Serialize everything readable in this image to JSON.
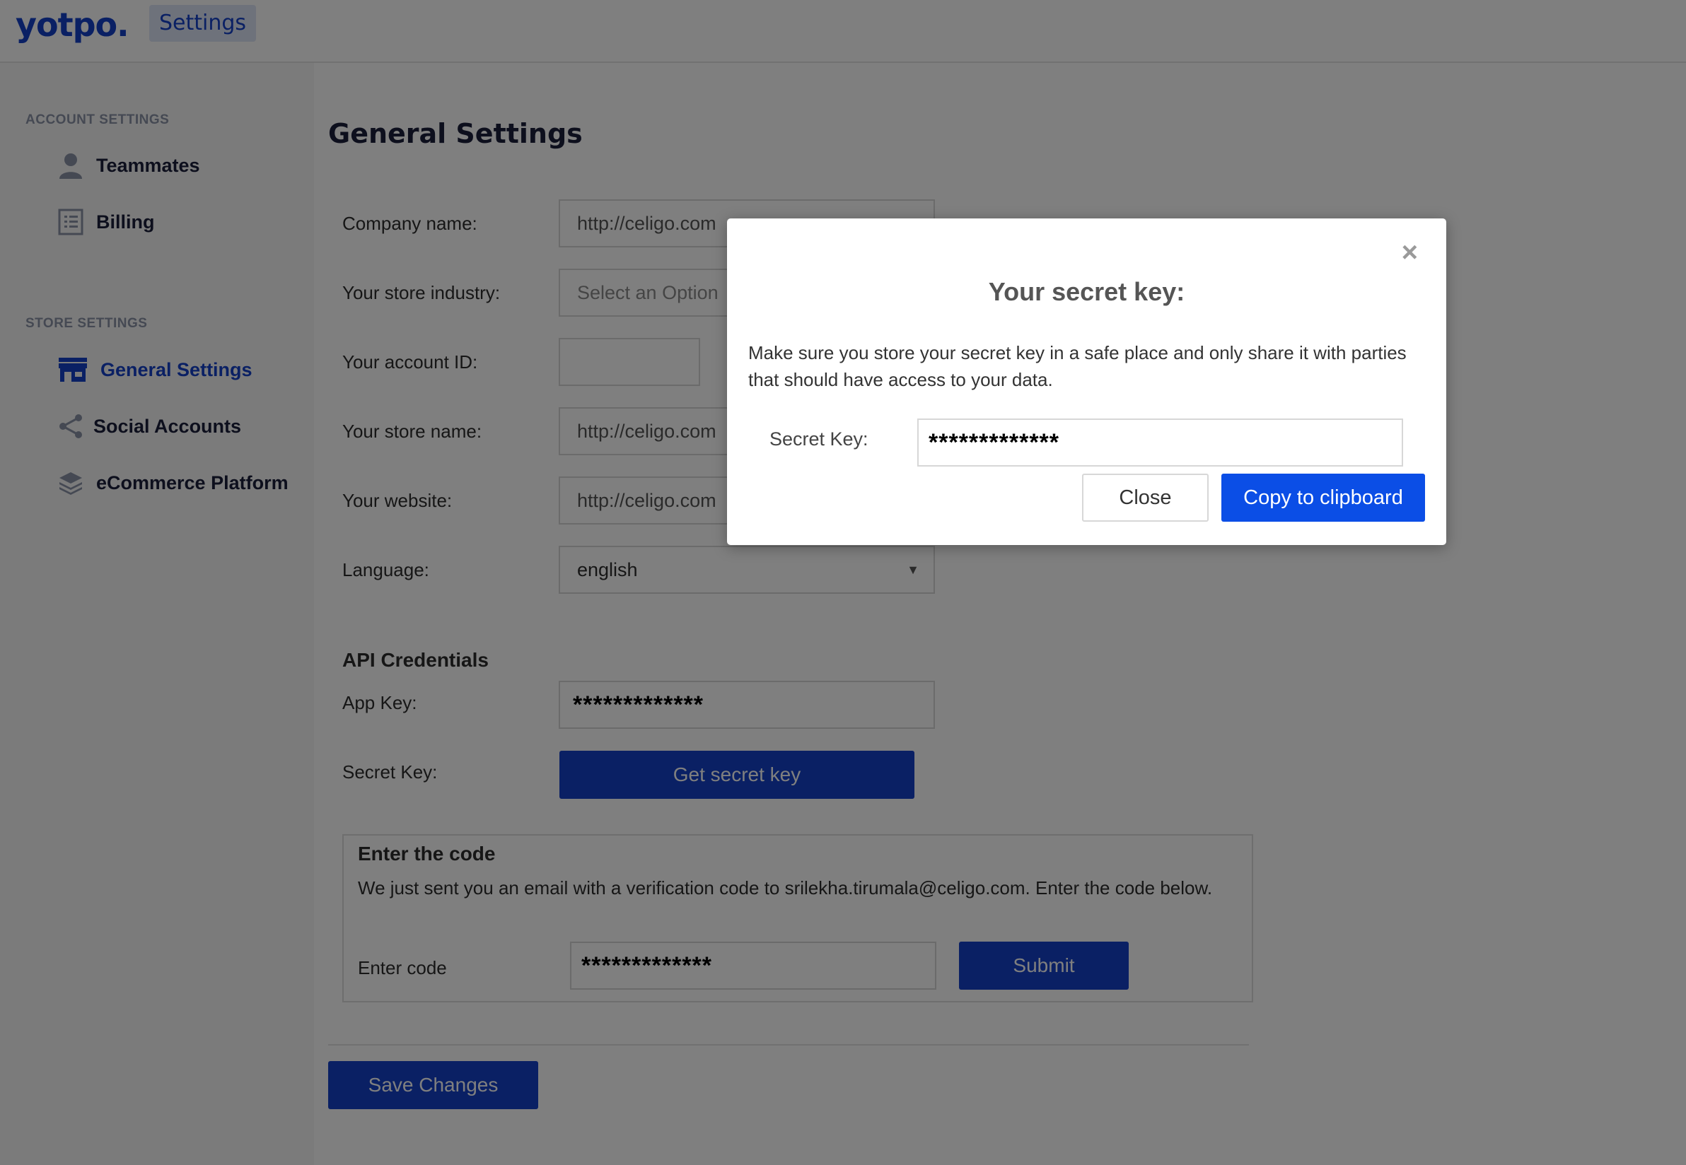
{
  "header": {
    "logo": "yotpo.",
    "tab_label": "Settings"
  },
  "sidebar": {
    "account_heading": "ACCOUNT SETTINGS",
    "store_heading": "STORE SETTINGS",
    "items": [
      {
        "label": "Teammates",
        "icon": "person-icon"
      },
      {
        "label": "Billing",
        "icon": "list-icon"
      },
      {
        "label": "General Settings",
        "icon": "store-icon",
        "active": true
      },
      {
        "label": "Social Accounts",
        "icon": "share-icon"
      },
      {
        "label": "eCommerce Platform",
        "icon": "layers-icon"
      }
    ]
  },
  "main": {
    "title": "General Settings",
    "fields": {
      "company_label": "Company name:",
      "company_value": "http://celigo.com",
      "industry_label": "Your store industry:",
      "industry_placeholder": "Select an Option",
      "account_id_label": "Your account ID:",
      "account_id_value": "",
      "store_name_label": "Your store name:",
      "store_name_value": "http://celigo.com",
      "website_label": "Your website:",
      "website_value": "http://celigo.com",
      "language_label": "Language:",
      "language_value": "english"
    },
    "api": {
      "title": "API Credentials",
      "app_key_label": "App Key:",
      "app_key_value": "*************",
      "secret_key_label": "Secret Key:",
      "get_secret_button": "Get secret key"
    },
    "code": {
      "title": "Enter the code",
      "description": "We just sent you an email with a verification code to srilekha.tirumala@celigo.com. Enter the code below.",
      "label": "Enter code",
      "value": "*************",
      "submit_button": "Submit"
    },
    "save_button": "Save Changes"
  },
  "modal": {
    "close_glyph": "×",
    "title": "Your secret key:",
    "message": "Make sure you store your secret key in a safe place and only share it with parties that should have access to your data.",
    "secret_label": "Secret Key:",
    "secret_value": "*************",
    "close_button": "Close",
    "copy_button": "Copy to clipboard"
  },
  "colors": {
    "brand_blue": "#1440c8",
    "copy_blue": "#0b4ee6",
    "overlay": "rgba(0,0,0,0.5)"
  }
}
